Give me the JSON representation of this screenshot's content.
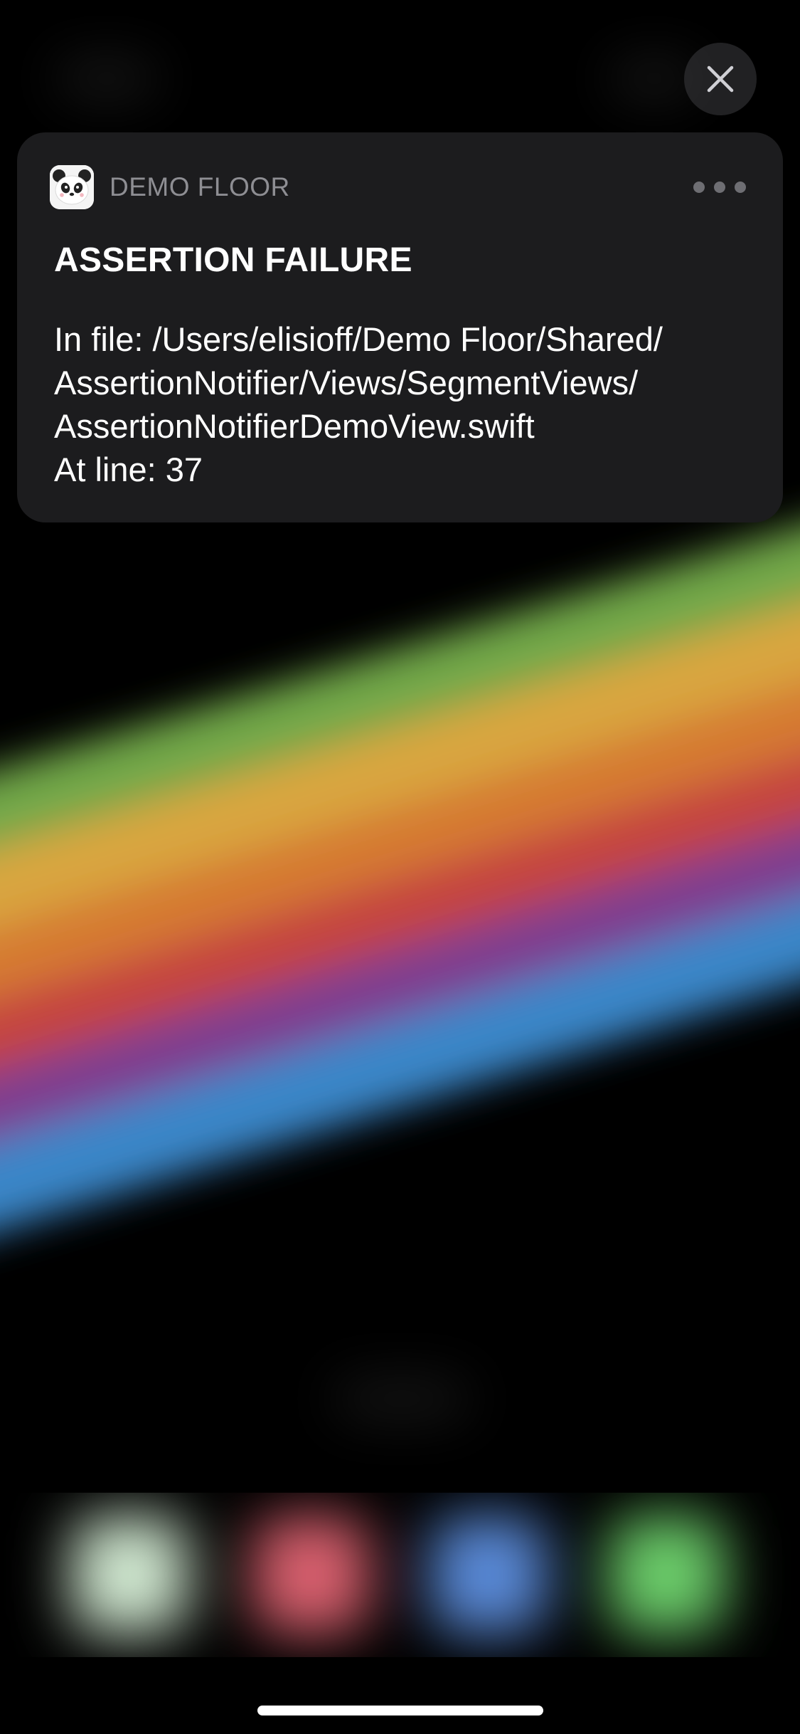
{
  "notification": {
    "app_name": "DEMO FLOOR",
    "app_icon": "panda-icon",
    "title": "ASSERTION FAILURE",
    "body_lines": [
      "In file: /Users/elisioff/Demo Floor/Shared/",
      "AssertionNotifier/Views/SegmentViews/",
      "AssertionNotifierDemoView.swift",
      "At line: 37"
    ],
    "more_icon": "ellipsis-icon"
  },
  "controls": {
    "close_icon": "close-icon"
  },
  "colors": {
    "background": "#000000",
    "card": "#1c1c1e",
    "app_name": "#8e8e93",
    "text": "#ffffff",
    "rainbow": [
      "#72a84a",
      "#d9a640",
      "#d57a32",
      "#c54440",
      "#7f3d8f",
      "#3b86c8"
    ],
    "dock_apps": [
      "#cfe6cf",
      "#d9606e",
      "#5a8ad8",
      "#6ccd6a"
    ]
  }
}
